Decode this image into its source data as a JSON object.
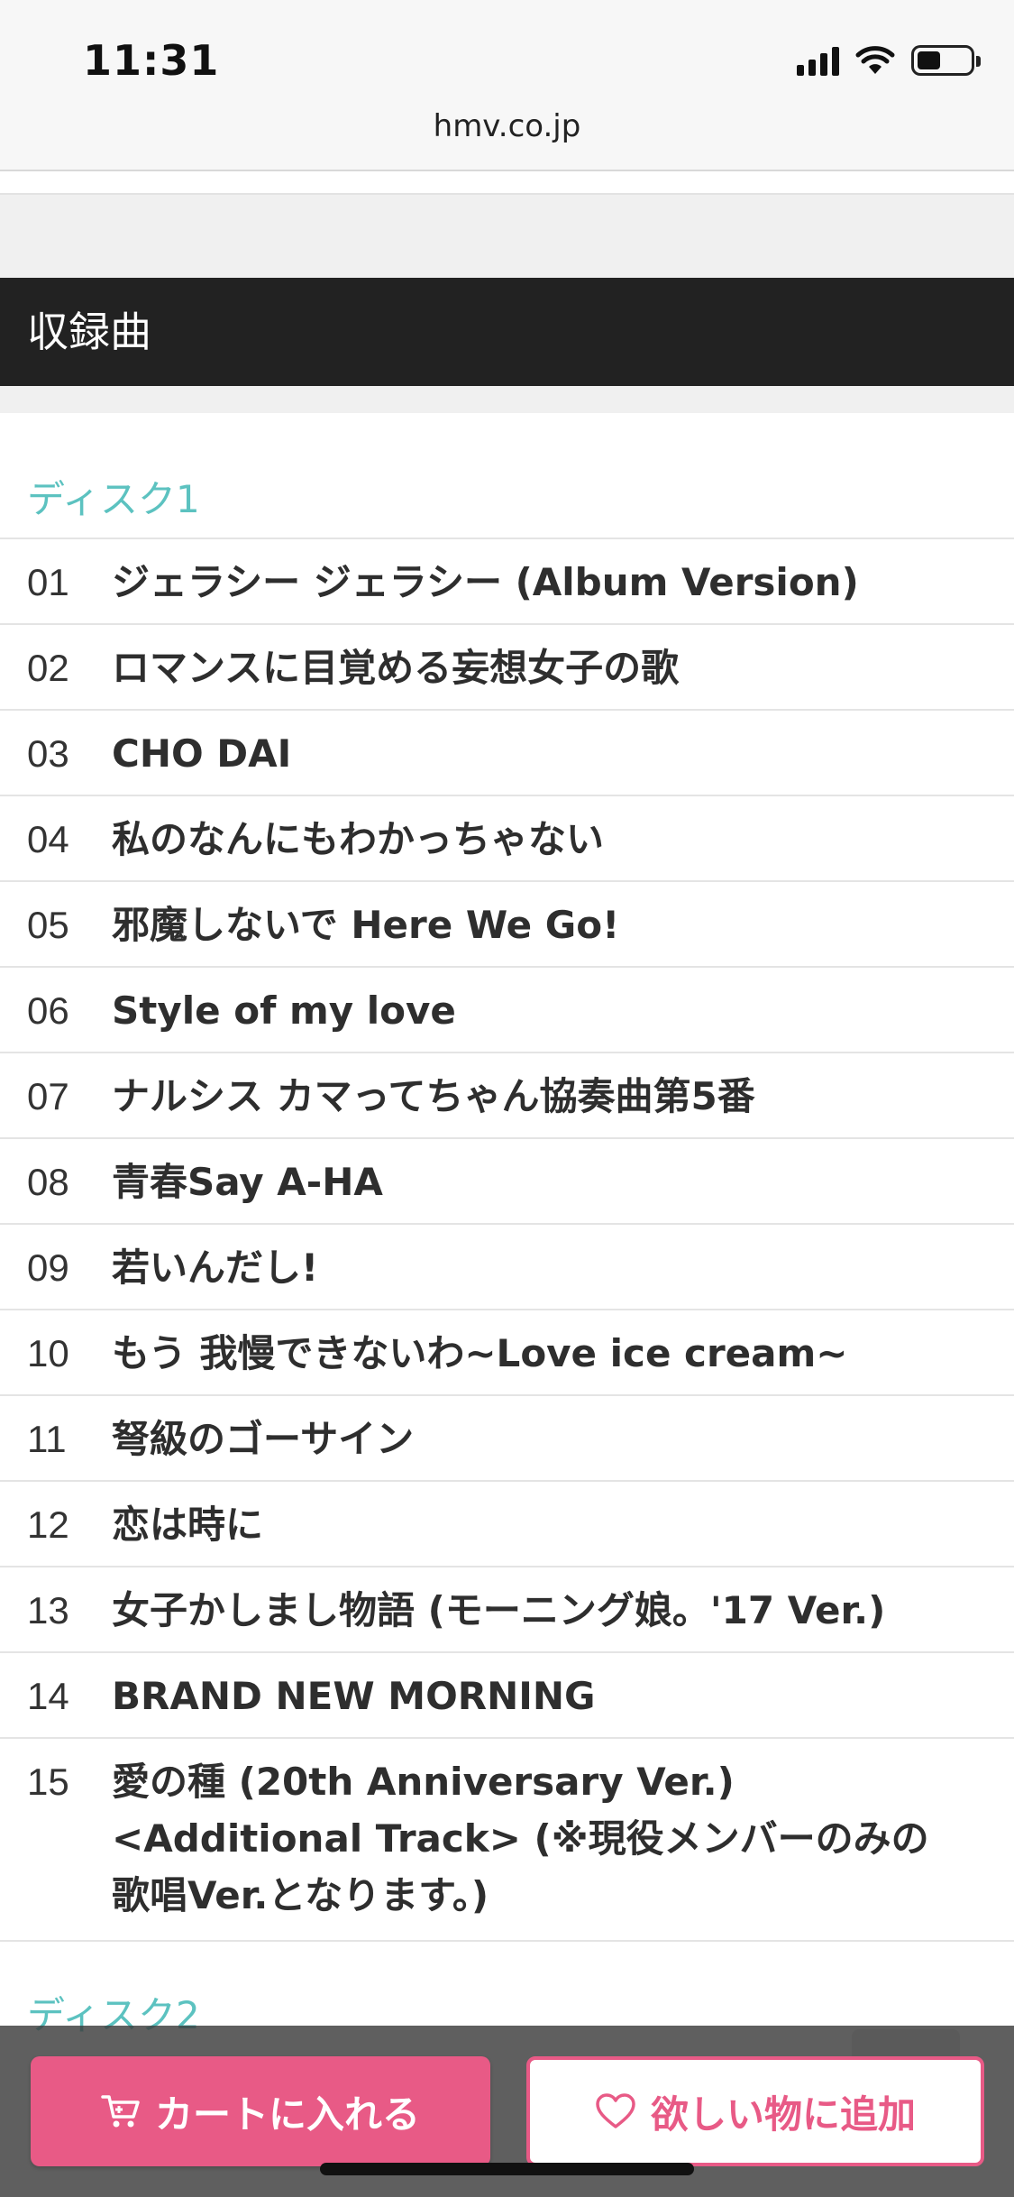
{
  "status_bar": {
    "time": "11:31",
    "url": "hmv.co.jp",
    "battery_level": 0.45
  },
  "section": {
    "title": "収録曲"
  },
  "discs": [
    {
      "title": "ディスク1",
      "tracks": [
        {
          "no": "01",
          "title": "ジェラシー ジェラシー (Album Version)"
        },
        {
          "no": "02",
          "title": "ロマンスに目覚める妄想女子の歌"
        },
        {
          "no": "03",
          "title": "CHO DAI"
        },
        {
          "no": "04",
          "title": "私のなんにもわかっちゃない"
        },
        {
          "no": "05",
          "title": "邪魔しないで Here We Go!"
        },
        {
          "no": "06",
          "title": "Style of my love"
        },
        {
          "no": "07",
          "title": "ナルシス カマってちゃん協奏曲第5番"
        },
        {
          "no": "08",
          "title": "青春Say A-HA"
        },
        {
          "no": "09",
          "title": "若いんだし!"
        },
        {
          "no": "10",
          "title": "もう 我慢できないわ~Love ice cream~"
        },
        {
          "no": "11",
          "title": "弩級のゴーサイン"
        },
        {
          "no": "12",
          "title": "恋は時に"
        },
        {
          "no": "13",
          "title": "女子かしまし物語 (モーニング娘。'17 Ver.)"
        },
        {
          "no": "14",
          "title": "BRAND NEW MORNING"
        },
        {
          "no": "15",
          "title": "愛の種 (20th Anniversary Ver.) <Additional Track> (※現役メンバーのみの歌唱Ver.となります。)"
        }
      ]
    },
    {
      "title": "ディスク2"
    }
  ],
  "actions": {
    "cart_label": "カートに入れる",
    "wishlist_label": "欲しい物に追加"
  },
  "colors": {
    "accent_pink": "#e85a86",
    "disc_teal": "#5cc2c0",
    "header_dark": "#222222"
  },
  "icons": {
    "cart": "cart-icon",
    "heart": "heart-icon",
    "wifi": "wifi-icon",
    "signal": "signal-icon",
    "battery": "battery-icon"
  }
}
